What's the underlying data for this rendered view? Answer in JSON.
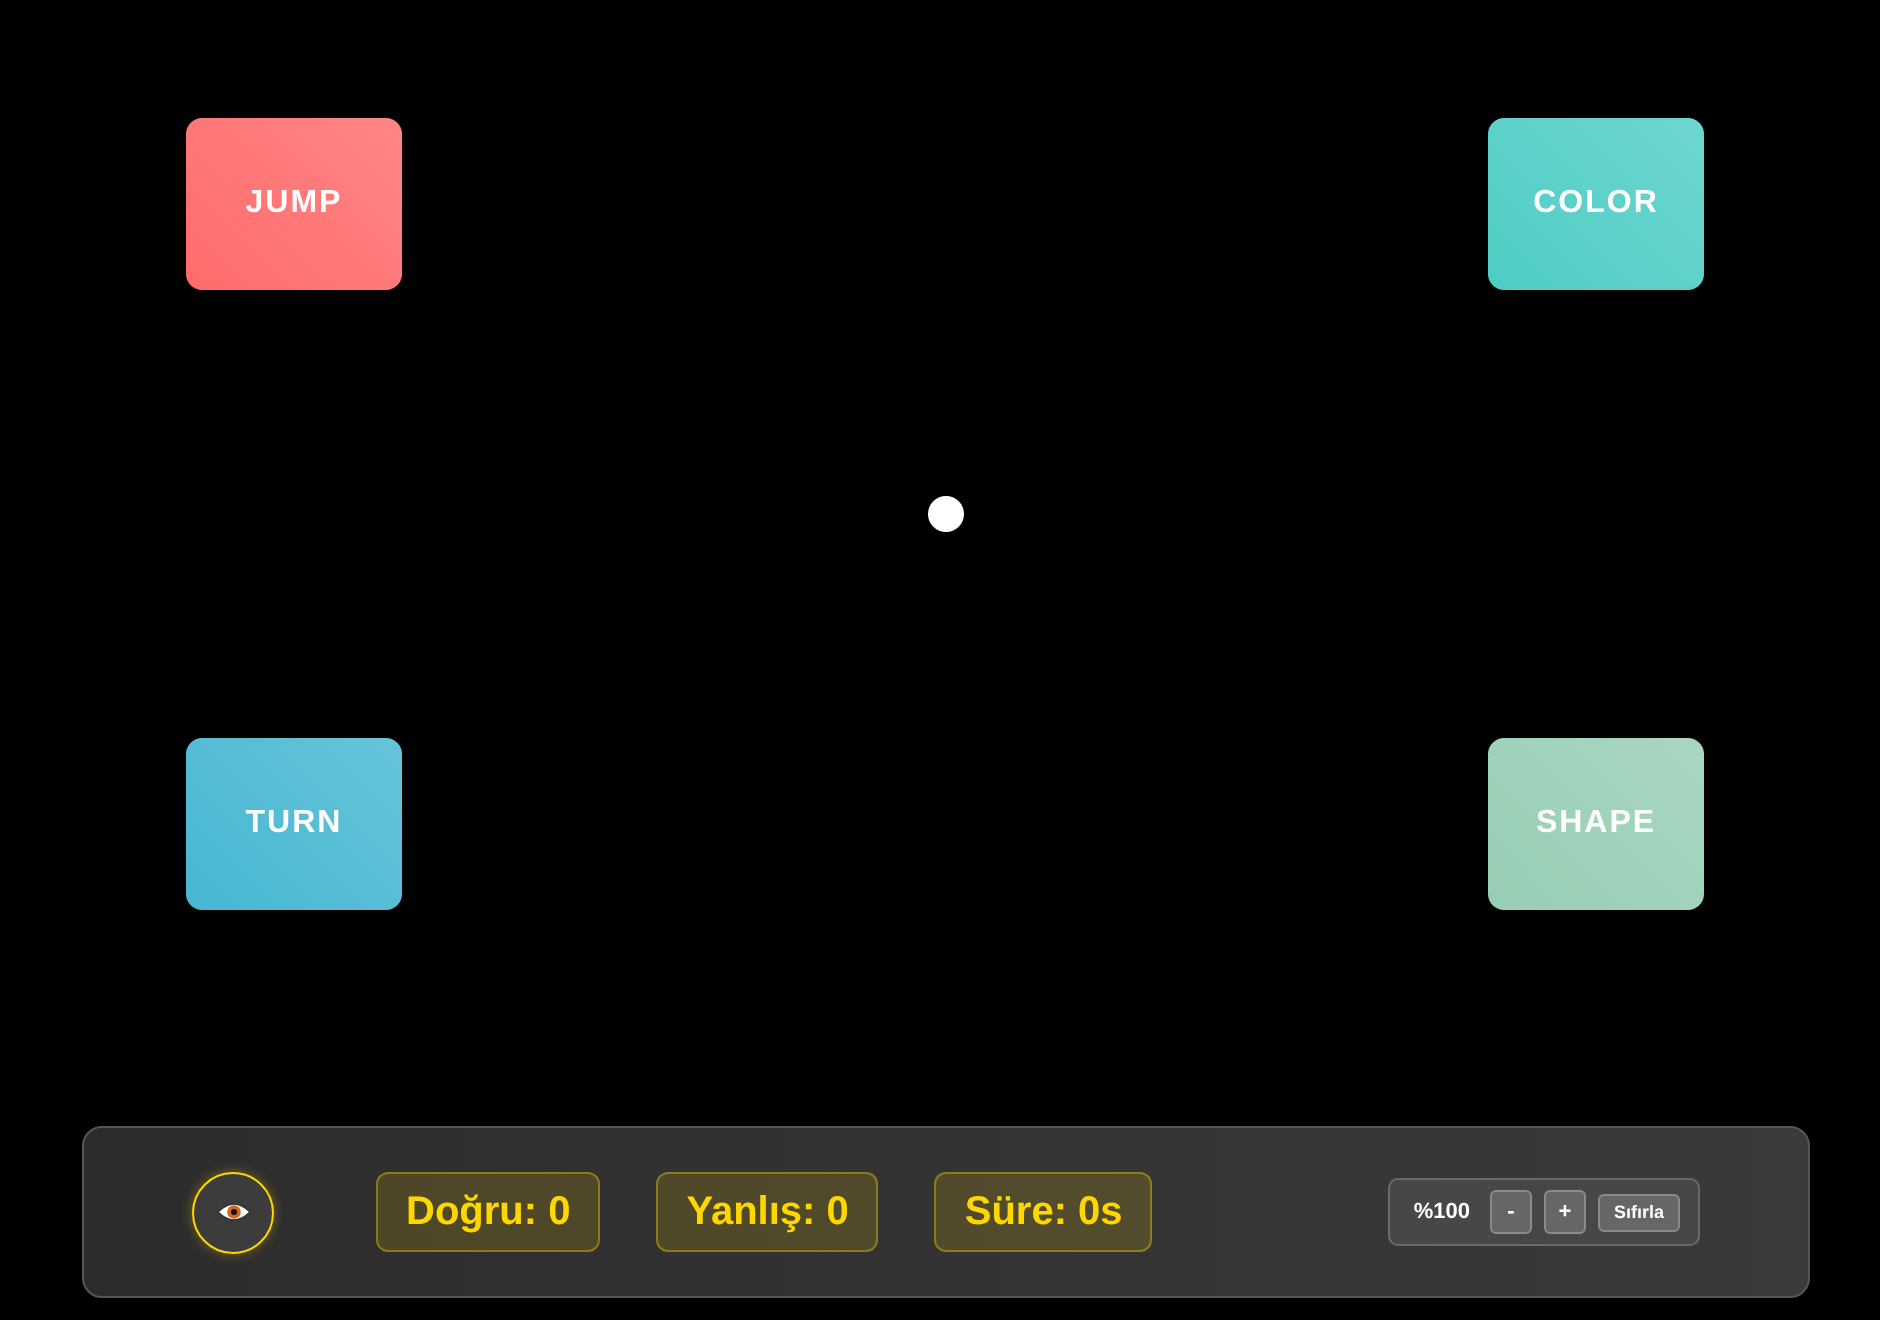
{
  "actions": [
    {
      "label": "JUMP",
      "color": "#ff6b6b"
    },
    {
      "label": "COLOR",
      "color": "#4ecdc4"
    },
    {
      "label": "TURN",
      "color": "#45b7d1"
    },
    {
      "label": "SHAPE",
      "color": "#96ceb4"
    }
  ],
  "stats": [
    "Doğru: 0",
    "Yanlış: 0",
    "Süre: 0s"
  ],
  "zoom": {
    "value": "%100",
    "decrease": "-",
    "increase": "+",
    "reset": "Sıfırla"
  }
}
